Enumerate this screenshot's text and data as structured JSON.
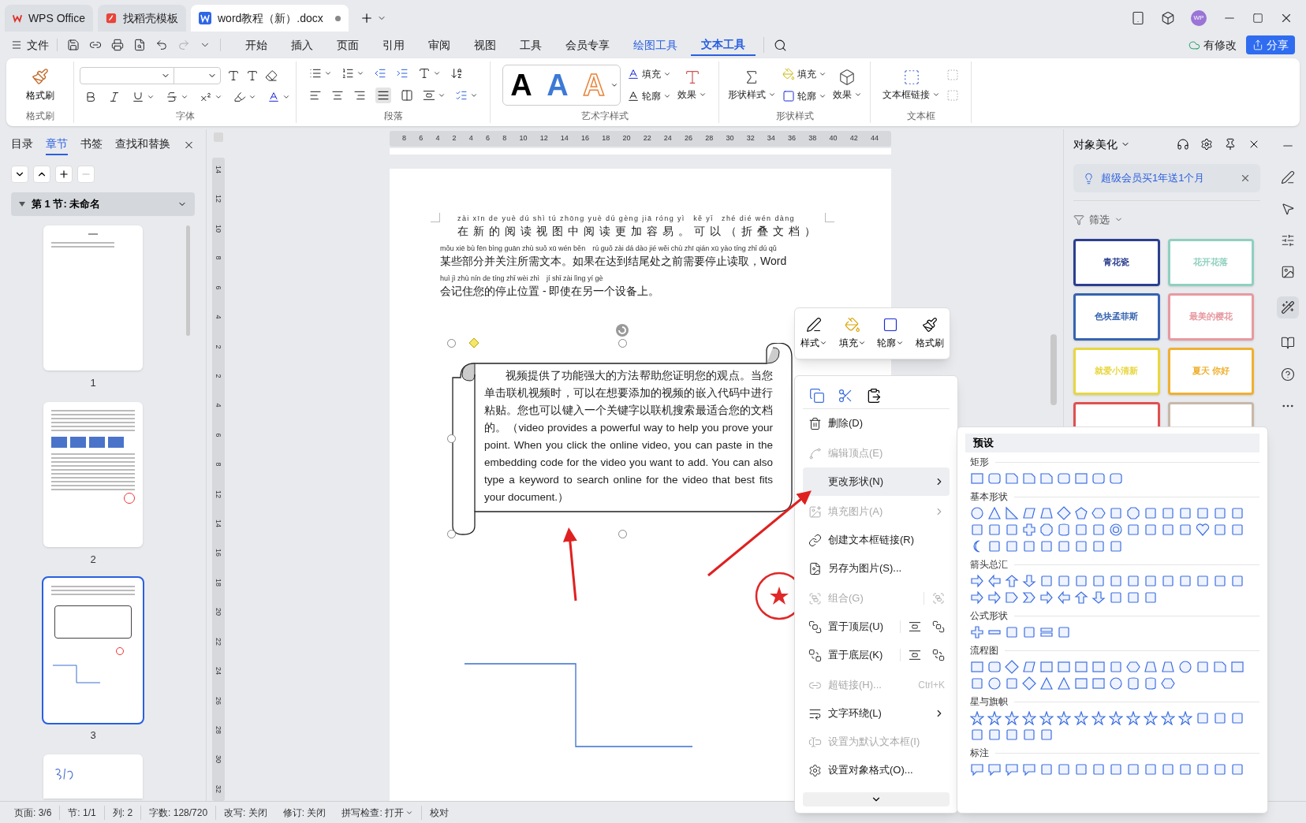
{
  "title_bar": {
    "tabs": [
      {
        "label": "WPS Office",
        "kind": "home",
        "selected": false
      },
      {
        "label": "找稻壳模板",
        "kind": "template",
        "selected": false
      },
      {
        "label": "word教程（新）.docx",
        "kind": "doc",
        "selected": true
      }
    ],
    "avatar": "WP"
  },
  "menu_bar": {
    "file": "文件",
    "tabs": [
      {
        "label": "开始",
        "kind": "normal",
        "selected": false
      },
      {
        "label": "插入",
        "kind": "normal",
        "selected": false
      },
      {
        "label": "页面",
        "kind": "normal",
        "selected": false
      },
      {
        "label": "引用",
        "kind": "normal",
        "selected": false
      },
      {
        "label": "审阅",
        "kind": "normal",
        "selected": false
      },
      {
        "label": "视图",
        "kind": "normal",
        "selected": false
      },
      {
        "label": "工具",
        "kind": "normal",
        "selected": false
      },
      {
        "label": "会员专享",
        "kind": "normal",
        "selected": false
      },
      {
        "label": "绘图工具",
        "kind": "context",
        "selected": false
      },
      {
        "label": "文本工具",
        "kind": "context",
        "selected": true
      }
    ],
    "status": "有修改",
    "share": "分享"
  },
  "ribbon": {
    "format_painter": {
      "label": "格式刷",
      "group": "格式刷"
    },
    "font": {
      "group": "字体"
    },
    "paragraph": {
      "group": "段落"
    },
    "art_text": {
      "group": "艺术字样式",
      "preview": [
        "A",
        "A",
        "A"
      ],
      "fill": "填充",
      "outline": "轮廓",
      "effect": "效果"
    },
    "shape_style": {
      "group": "形状样式",
      "style": "形状样式",
      "fill": "填充",
      "outline": "轮廓",
      "effect": "效果"
    },
    "text_box": {
      "group": "文本框",
      "link": "文本框链接"
    }
  },
  "nav_panel": {
    "tabs": [
      {
        "label": "目录",
        "selected": false
      },
      {
        "label": "章节",
        "selected": true
      },
      {
        "label": "书签",
        "selected": false
      },
      {
        "label": "查找和替换",
        "selected": false
      }
    ],
    "section": "第 1 节: 未命名",
    "pages": [
      {
        "number": "1",
        "kind": "toc",
        "selected": false
      },
      {
        "number": "2",
        "kind": "text",
        "selected": false
      },
      {
        "number": "3",
        "kind": "scroll",
        "selected": true
      },
      {
        "kind": "signature"
      }
    ]
  },
  "h_ruler": [
    "8",
    "6",
    "4",
    "2",
    "4",
    "6",
    "8",
    "10",
    "12",
    "14",
    "16",
    "18",
    "20",
    "22",
    "24",
    "26",
    "28",
    "30",
    "32",
    "34",
    "36",
    "38",
    "40",
    "42",
    "44"
  ],
  "v_ruler": [
    "14",
    "12",
    "10",
    "8",
    "6",
    "4",
    "2",
    "2",
    "4",
    "6",
    "8",
    "12",
    "14",
    "16",
    "18",
    "20",
    "22",
    "24",
    "26",
    "28",
    "30",
    "32"
  ],
  "document": {
    "lines": [
      {
        "pinyin": "zài xīn de yuè dú shì tú zhōng yuè dú gèng jiā róng yì　kě yǐ　zhé dié wén dàng",
        "text": "在新的阅读视图中阅读更加容易。可以（折叠文档）",
        "kind": "spaced"
      },
      {
        "pinyin": "mǒu xiē bù fēn bìng guān zhù suǒ xū wén běn　rú guǒ zài dá dào jié wěi chù zhī qián xū yào tíng zhǐ dú qǔ",
        "text": "某些部分并关注所需文本。如果在达到结尾处之前需要停止读取，Word",
        "kind": "normal"
      },
      {
        "pinyin": "huì jì zhù nín de tíng zhǐ wèi zhì　jí shǐ zài lìng yí gè",
        "text": "会记住您的停止位置 - 即使在另一个设备上。",
        "kind": "normal"
      }
    ],
    "scroll_text": "视频提供了功能强大的方法帮助您证明您的观点。当您单击联机视频时，可以在想要添加的视频的嵌入代码中进行粘贴。您也可以键入一个关键字以联机搜索最适合您的文档的。（video provides a powerful way to help you prove your point. When you click the online video, you can paste in the embedding code for the video you want to add. You can also type a keyword to search online for the video that best fits your document.）"
  },
  "mini_toolbar": [
    {
      "label": "样式",
      "dropdown": true
    },
    {
      "label": "填充",
      "dropdown": true
    },
    {
      "label": "轮廓",
      "dropdown": true
    },
    {
      "label": "格式刷",
      "dropdown": false
    }
  ],
  "context_menu": [
    {
      "kind": "delete",
      "label": "删除(D)",
      "disabled": false,
      "selected": false,
      "submenu": false
    },
    {
      "kind": "edit-points",
      "label": "编辑顶点(E)",
      "disabled": true,
      "selected": false,
      "submenu": false
    },
    {
      "kind": "change-shape",
      "label": "更改形状(N)",
      "disabled": false,
      "selected": true,
      "submenu": true
    },
    {
      "kind": "fill-picture",
      "label": "填充图片(A)",
      "disabled": true,
      "selected": false,
      "submenu": true
    },
    {
      "kind": "textbox-link",
      "label": "创建文本框链接(R)",
      "disabled": false,
      "selected": false,
      "submenu": false
    },
    {
      "kind": "save-picture",
      "label": "另存为图片(S)...",
      "disabled": false,
      "selected": false,
      "submenu": false
    },
    {
      "kind": "group",
      "label": "组合(G)",
      "disabled": true,
      "selected": false,
      "submenu": false
    },
    {
      "kind": "bring-front",
      "label": "置于顶层(U)",
      "disabled": false,
      "selected": false,
      "submenu": false
    },
    {
      "kind": "send-back",
      "label": "置于底层(K)",
      "disabled": false,
      "selected": false,
      "submenu": false
    },
    {
      "kind": "hyperlink",
      "label": "超链接(H)...",
      "shortcut": "Ctrl+K",
      "disabled": true,
      "selected": false,
      "submenu": false
    },
    {
      "kind": "text-wrap",
      "label": "文字环绕(L)",
      "disabled": false,
      "selected": false,
      "submenu": true
    },
    {
      "kind": "default-textbox",
      "label": "设置为默认文本框(I)",
      "disabled": true,
      "selected": false,
      "submenu": false
    },
    {
      "kind": "format-object",
      "label": "设置对象格式(O)...",
      "disabled": false,
      "selected": false,
      "submenu": false
    }
  ],
  "shapes_menu": {
    "title": "预设",
    "categories": [
      {
        "title": "矩形"
      },
      {
        "title": "基本形状"
      },
      {
        "title": "箭头总汇"
      },
      {
        "title": "公式形状"
      },
      {
        "title": "流程图"
      },
      {
        "title": "星与旗帜"
      },
      {
        "title": "标注"
      }
    ]
  },
  "right_panel": {
    "title": "对象美化",
    "promo": "超级会员买1年送1个月",
    "filter": "筛选",
    "templates": [
      {
        "title": "青花瓷",
        "color": "#2b3f8f"
      },
      {
        "title": "花开花落",
        "color": "#8fd0c0"
      },
      {
        "title": "色块孟菲斯",
        "color": "#3563b0"
      },
      {
        "title": "最美的樱花",
        "color": "#e79aa0"
      },
      {
        "title": "就爱小清新",
        "color": "#e8d640"
      },
      {
        "title": "夏天 你好",
        "color": "#f0b030"
      },
      {
        "color": "#e05050"
      },
      {
        "color": "#c8b8a8"
      }
    ]
  },
  "status_bar": [
    {
      "label": "页面: 3/6",
      "dropdown": false
    },
    {
      "label": "节: 1/1",
      "dropdown": false
    },
    {
      "label": "列: 2",
      "dropdown": false
    },
    {
      "label": "字数: 128/720",
      "dropdown": false
    },
    {
      "label": "改写: 关闭",
      "dropdown": false
    },
    {
      "label": "修订: 关闭",
      "dropdown": false
    },
    {
      "label": "拼写检查: 打开",
      "dropdown": true
    },
    {
      "label": "校对",
      "dropdown": false
    }
  ]
}
